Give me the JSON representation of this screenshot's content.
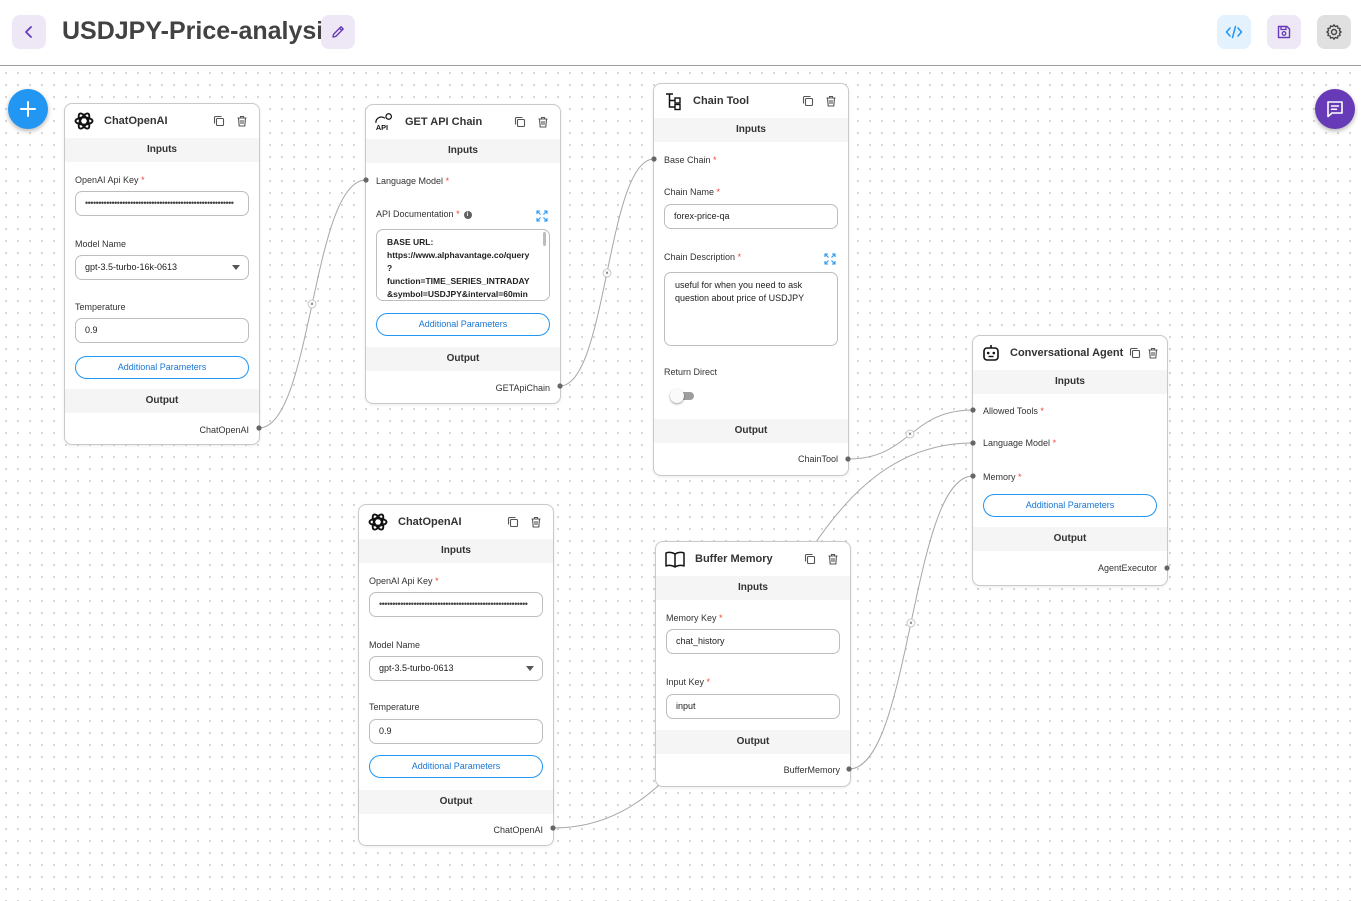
{
  "header": {
    "title": "USDJPY-Price-analysis",
    "icons": [
      "chevron-left-icon",
      "pencil-icon",
      "code-icon",
      "save-icon",
      "gear-icon"
    ]
  },
  "fabs": {
    "add_icon": "plus-icon",
    "chat_icon": "chat-icon"
  },
  "colors": {
    "accent_blue": "#2196f3",
    "accent_purple": "#673ab7",
    "required": "#f44336"
  },
  "common": {
    "inputs": "Inputs",
    "output": "Output",
    "required_mark": "*",
    "additional_parameters": "Additional Parameters"
  },
  "nodes": {
    "chat1": {
      "title": "ChatOpenAI",
      "api_key_label": "OpenAI Api Key",
      "api_key_value": "••••••••••••••••••••••••••••••••••••••••••••••••••••••••",
      "model_label": "Model Name",
      "model_value": "gpt-3.5-turbo-16k-0613",
      "temp_label": "Temperature",
      "temp_value": "0.9",
      "output_label": "ChatOpenAI"
    },
    "getapi": {
      "title": "GET API Chain",
      "lm_label": "Language Model",
      "doc_label": "API Documentation",
      "doc_value": "BASE URL:\nhttps://www.alphavantage.co/query\n?\nfunction=TIME_SERIES_INTRADAY\n&symbol=USDJPY&interval=60min",
      "output_label": "GETApiChain"
    },
    "chaintool": {
      "title": "Chain Tool",
      "base_chain_label": "Base Chain",
      "name_label": "Chain Name",
      "name_value": "forex-price-qa",
      "desc_label": "Chain Description",
      "desc_value": "useful for when you need to ask question about price of USDJPY",
      "return_label": "Return Direct",
      "output_label": "ChainTool"
    },
    "agent": {
      "title": "Conversational Agent",
      "tools_label": "Allowed Tools",
      "lm_label": "Language Model",
      "memory_label": "Memory",
      "output_label": "AgentExecutor"
    },
    "chat2": {
      "title": "ChatOpenAI",
      "api_key_label": "OpenAI Api Key",
      "api_key_value": "••••••••••••••••••••••••••••••••••••••••••••••••••••••••",
      "model_label": "Model Name",
      "model_value": "gpt-3.5-turbo-0613",
      "temp_label": "Temperature",
      "temp_value": "0.9",
      "output_label": "ChatOpenAI"
    },
    "buffer": {
      "title": "Buffer Memory",
      "memkey_label": "Memory Key",
      "memkey_value": "chat_history",
      "inputkey_label": "Input Key",
      "inputkey_value": "input",
      "output_label": "BufferMemory"
    }
  }
}
